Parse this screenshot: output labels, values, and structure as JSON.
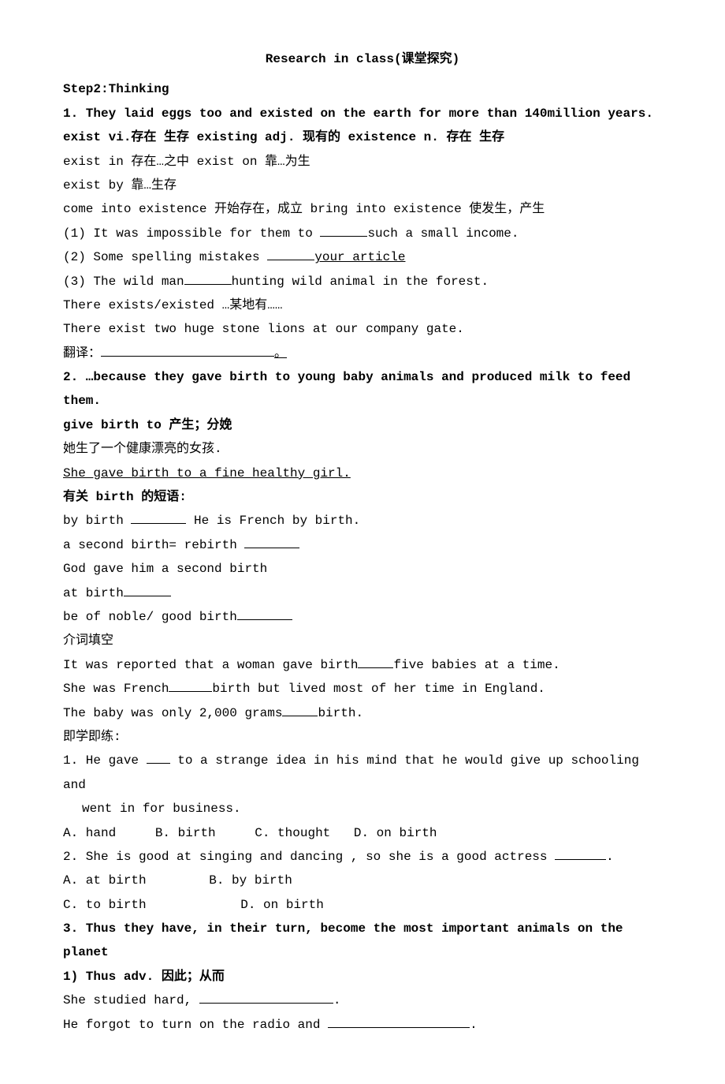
{
  "title": "Research in class(课堂探究)",
  "step": "Step2:Thinking",
  "s1": {
    "header": "1. They laid eggs too and existed on the earth for more than 140million years.",
    "sub": "exist vi.存在 生存    existing adj. 现有的   existence n. 存在 生存",
    "l1": "exist in   存在…之中  exist on  靠…为生",
    "l2": "exist by   靠…生存",
    "l3": "come into existence 开始存在，成立  bring into existence 使发生，产生",
    "q1a": "(1) It was impossible for them to ",
    "q1b": "such a small income.",
    "q2a": "(2) Some spelling mistakes ",
    "q2b": "your article",
    "q3a": "(3) The wild man",
    "q3b": "hunting wild animal in the forest.",
    "t1": "There exists/existed …某地有……",
    "t2": "There exist two huge stone lions at our company gate.",
    "tr": "翻译：",
    "period": "。"
  },
  "s2": {
    "header": "2. …because they gave birth to young baby animals and produced milk to feed them.",
    "sub": "give birth to 产生；分娩",
    "zh": "她生了一个健康漂亮的女孩.",
    "en": "She gave birth to a fine healthy girl.",
    "birth_header": "有关 birth 的短语:",
    "by": "by birth ",
    "by2": "  He is French by birth.",
    "second": "a second birth= rebirth ",
    "god": "God gave him a second birth",
    "at": "at birth",
    "noble": "be of noble/ good birth",
    "prep_header": "介词填空",
    "p1a": "It was reported that a woman gave birth",
    "p1b": "five babies at a time.",
    "p2a": "She was French",
    "p2b": "birth but lived most of her time in England.",
    "p3a": "The baby was only 2,000 grams",
    "p3b": "birth.",
    "practice_header": "即学即练:",
    "q1a": "1. He gave ",
    "q1b": " to a strange idea in his mind that he would give up schooling and",
    "q1c": "went in for business.",
    "q1opts": {
      "a": "A. hand",
      "b": "B. birth",
      "c": "C. thought",
      "d": "D. on birth"
    },
    "q2": "2. She is good at singing and dancing , so she is a good actress ",
    "q2p": ".",
    "q2opts": {
      "a": "A. at birth",
      "b": "B. by birth",
      "c": "C. to birth",
      "d": "D. on birth"
    }
  },
  "s3": {
    "header": "3. Thus they have, in their turn, become the most important animals on the planet",
    "sub": "1) Thus adv. 因此；从而",
    "l1a": "She studied hard, ",
    "l1p": ".",
    "l2a": "He forgot to turn on the radio and ",
    "l2p": "."
  }
}
